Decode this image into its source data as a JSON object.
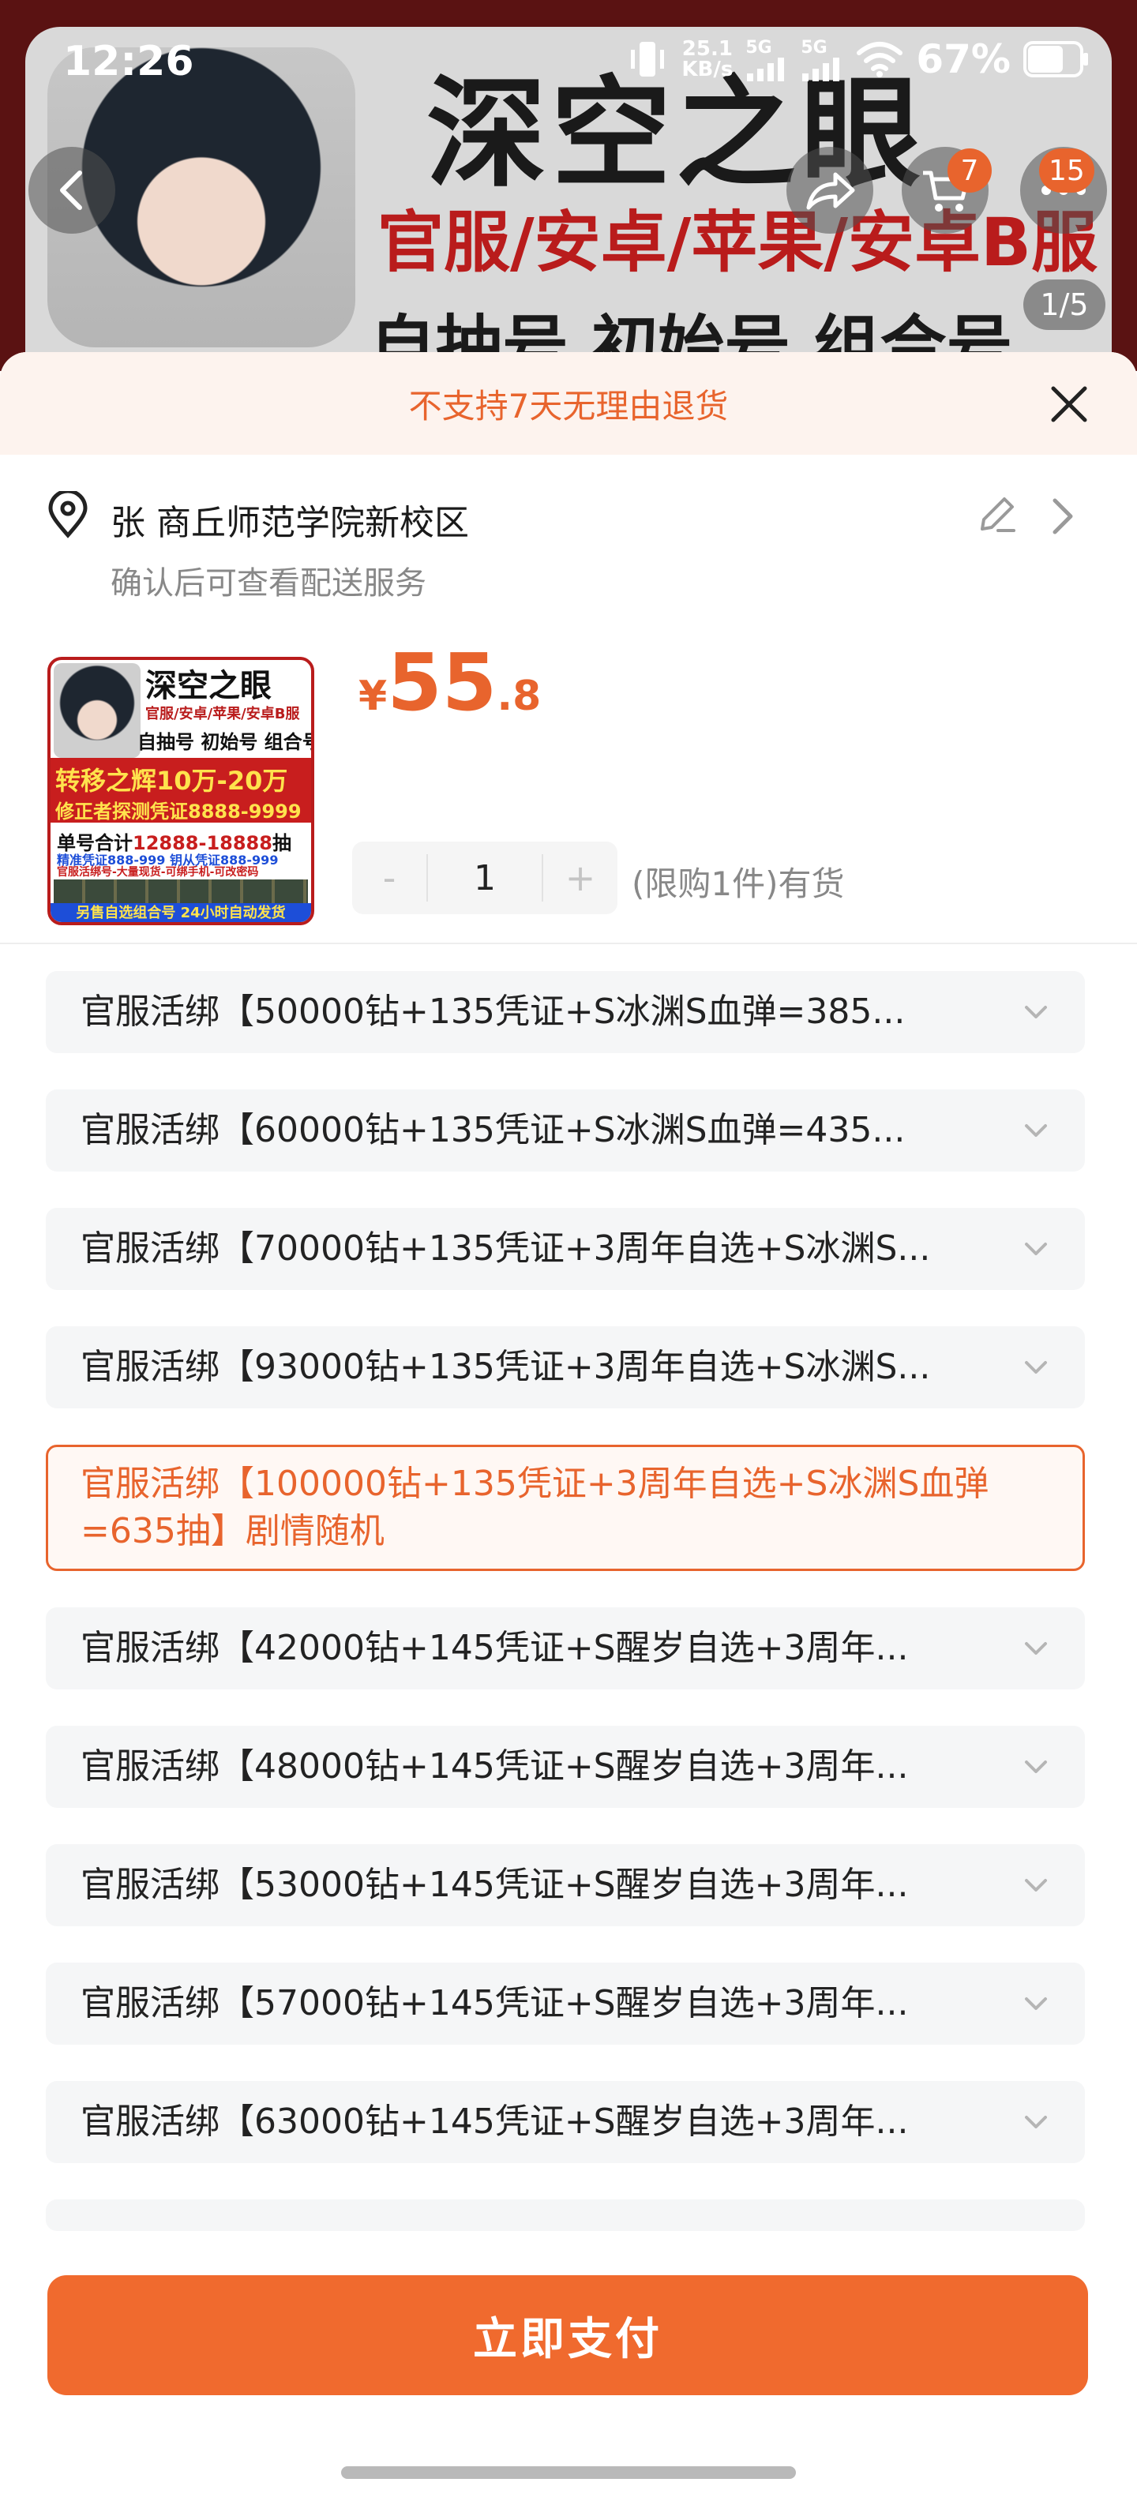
{
  "status_bar": {
    "time": "12:26",
    "net_speed_value": "25.1",
    "net_speed_unit": "KB/s",
    "signal_label_1": "5G",
    "signal_label_2": "5G",
    "battery": "67%"
  },
  "banner": {
    "title": "深空之眼",
    "subtitle_1": "官服/安卓/苹果/安卓B服",
    "subtitle_2": "自抽号 初始号 组合号",
    "cart_badge": "7",
    "more_badge": "15",
    "page_indicator": "1/5"
  },
  "sheet": {
    "notice": "不支持7天无理由退货",
    "address": "张 商丘师范学院新校区",
    "delivery_hint": "确认后可查看配送服务",
    "price": {
      "currency": "¥",
      "integer": "55",
      "decimal": ".8"
    },
    "thumb": {
      "title": "深空之眼",
      "sub": "官服/安卓/苹果/安卓B服",
      "sub2": "自抽号 初始号 组合号",
      "red_line_1": "转移之辉10万-20万",
      "red_line_2": "修正者探测凭证8888-9999",
      "line_1_prefix": "单号合计",
      "line_1_value": "12888-18888",
      "line_1_suffix": "抽",
      "line_2": "精准凭证888-999 钥从凭证888-999",
      "line_3": "官服活绑号-大量现货-可绑手机-可改密码",
      "footer": "另售自选组合号 24小时自动发货"
    },
    "stepper": {
      "minus": "-",
      "quantity": "1",
      "plus": "+"
    },
    "stock_text": "(限购1件)有货",
    "sku_options": [
      {
        "label": "官服活绑【50000钻+135凭证+S冰渊S血弹=385..."
      },
      {
        "label": "官服活绑【60000钻+135凭证+S冰渊S血弹=435..."
      },
      {
        "label": "官服活绑【70000钻+135凭证+3周年自选+S冰渊S..."
      },
      {
        "label": "官服活绑【93000钻+135凭证+3周年自选+S冰渊S..."
      },
      {
        "label": "官服活绑【100000钻+135凭证+3周年自选+S冰渊S血弹=635抽】剧情随机"
      },
      {
        "label": "官服活绑【42000钻+145凭证+S醒岁自选+3周年..."
      },
      {
        "label": "官服活绑【48000钻+145凭证+S醒岁自选+3周年..."
      },
      {
        "label": "官服活绑【53000钻+145凭证+S醒岁自选+3周年..."
      },
      {
        "label": "官服活绑【57000钻+145凭证+S醒岁自选+3周年..."
      },
      {
        "label": "官服活绑【63000钻+145凭证+S醒岁自选+3周年..."
      }
    ],
    "selected_index": 4,
    "pay_button": "立即支付"
  },
  "colors": {
    "accent": "#e8642d",
    "notice_bg": "#fdf3ee",
    "option_bg": "#f5f6f7"
  }
}
